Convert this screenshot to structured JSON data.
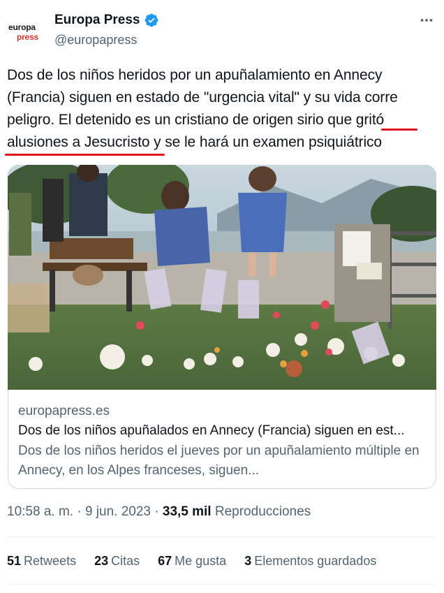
{
  "account": {
    "avatar_line1": "europa",
    "avatar_line2": "press",
    "name": "Europa Press",
    "handle": "@europapress",
    "verified_color": "#1d9bf0"
  },
  "tweet": {
    "text_part1": "Dos de los niños heridos por un apuñalamiento en Annecy (Francia) siguen en estado de \"urgencia vital\" y su vida corre peligro. El detenido es un cristiano de origen sirio que ",
    "text_highlight1": "gritó",
    "text_part2": " ",
    "text_highlight2": "alusiones a Jesucristo",
    "text_part3": " y se le hará un examen psiquiátrico",
    "annotation_color": "#e2121a"
  },
  "link_card": {
    "domain": "europapress.es",
    "title": "Dos de los niños apuñalados en Annecy (Francia) siguen en est...",
    "description": "Dos de los niños heridos el jueves por un apuñalamiento múltiple en Annecy, en los Alpes franceses, siguen..."
  },
  "meta": {
    "time": "10:58 a. m.",
    "sep1": " · ",
    "date": "9 jun. 2023",
    "sep2": " · ",
    "views_count": "33,5 mil",
    "views_label": " Reproducciones"
  },
  "stats": [
    {
      "count": "51",
      "label": "Retweets"
    },
    {
      "count": "23",
      "label": "Citas"
    },
    {
      "count": "67",
      "label": "Me gusta"
    },
    {
      "count": "3",
      "label": "Elementos guardados"
    }
  ],
  "icons": {
    "more": "more-horizontal-icon",
    "verified": "verified-badge-icon"
  }
}
